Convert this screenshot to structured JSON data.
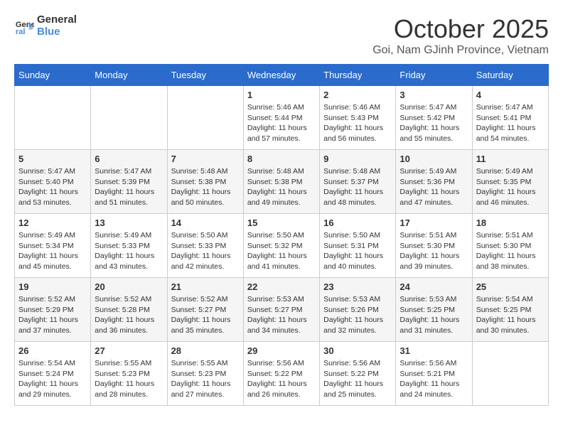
{
  "logo": {
    "line1": "General",
    "line2": "Blue"
  },
  "title": "October 2025",
  "location": "Goi, Nam GJinh Province, Vietnam",
  "days_of_week": [
    "Sunday",
    "Monday",
    "Tuesday",
    "Wednesday",
    "Thursday",
    "Friday",
    "Saturday"
  ],
  "weeks": [
    [
      {
        "day": "",
        "detail": ""
      },
      {
        "day": "",
        "detail": ""
      },
      {
        "day": "",
        "detail": ""
      },
      {
        "day": "1",
        "detail": "Sunrise: 5:46 AM\nSunset: 5:44 PM\nDaylight: 11 hours\nand 57 minutes."
      },
      {
        "day": "2",
        "detail": "Sunrise: 5:46 AM\nSunset: 5:43 PM\nDaylight: 11 hours\nand 56 minutes."
      },
      {
        "day": "3",
        "detail": "Sunrise: 5:47 AM\nSunset: 5:42 PM\nDaylight: 11 hours\nand 55 minutes."
      },
      {
        "day": "4",
        "detail": "Sunrise: 5:47 AM\nSunset: 5:41 PM\nDaylight: 11 hours\nand 54 minutes."
      }
    ],
    [
      {
        "day": "5",
        "detail": "Sunrise: 5:47 AM\nSunset: 5:40 PM\nDaylight: 11 hours\nand 53 minutes."
      },
      {
        "day": "6",
        "detail": "Sunrise: 5:47 AM\nSunset: 5:39 PM\nDaylight: 11 hours\nand 51 minutes."
      },
      {
        "day": "7",
        "detail": "Sunrise: 5:48 AM\nSunset: 5:38 PM\nDaylight: 11 hours\nand 50 minutes."
      },
      {
        "day": "8",
        "detail": "Sunrise: 5:48 AM\nSunset: 5:38 PM\nDaylight: 11 hours\nand 49 minutes."
      },
      {
        "day": "9",
        "detail": "Sunrise: 5:48 AM\nSunset: 5:37 PM\nDaylight: 11 hours\nand 48 minutes."
      },
      {
        "day": "10",
        "detail": "Sunrise: 5:49 AM\nSunset: 5:36 PM\nDaylight: 11 hours\nand 47 minutes."
      },
      {
        "day": "11",
        "detail": "Sunrise: 5:49 AM\nSunset: 5:35 PM\nDaylight: 11 hours\nand 46 minutes."
      }
    ],
    [
      {
        "day": "12",
        "detail": "Sunrise: 5:49 AM\nSunset: 5:34 PM\nDaylight: 11 hours\nand 45 minutes."
      },
      {
        "day": "13",
        "detail": "Sunrise: 5:49 AM\nSunset: 5:33 PM\nDaylight: 11 hours\nand 43 minutes."
      },
      {
        "day": "14",
        "detail": "Sunrise: 5:50 AM\nSunset: 5:33 PM\nDaylight: 11 hours\nand 42 minutes."
      },
      {
        "day": "15",
        "detail": "Sunrise: 5:50 AM\nSunset: 5:32 PM\nDaylight: 11 hours\nand 41 minutes."
      },
      {
        "day": "16",
        "detail": "Sunrise: 5:50 AM\nSunset: 5:31 PM\nDaylight: 11 hours\nand 40 minutes."
      },
      {
        "day": "17",
        "detail": "Sunrise: 5:51 AM\nSunset: 5:30 PM\nDaylight: 11 hours\nand 39 minutes."
      },
      {
        "day": "18",
        "detail": "Sunrise: 5:51 AM\nSunset: 5:30 PM\nDaylight: 11 hours\nand 38 minutes."
      }
    ],
    [
      {
        "day": "19",
        "detail": "Sunrise: 5:52 AM\nSunset: 5:29 PM\nDaylight: 11 hours\nand 37 minutes."
      },
      {
        "day": "20",
        "detail": "Sunrise: 5:52 AM\nSunset: 5:28 PM\nDaylight: 11 hours\nand 36 minutes."
      },
      {
        "day": "21",
        "detail": "Sunrise: 5:52 AM\nSunset: 5:27 PM\nDaylight: 11 hours\nand 35 minutes."
      },
      {
        "day": "22",
        "detail": "Sunrise: 5:53 AM\nSunset: 5:27 PM\nDaylight: 11 hours\nand 34 minutes."
      },
      {
        "day": "23",
        "detail": "Sunrise: 5:53 AM\nSunset: 5:26 PM\nDaylight: 11 hours\nand 32 minutes."
      },
      {
        "day": "24",
        "detail": "Sunrise: 5:53 AM\nSunset: 5:25 PM\nDaylight: 11 hours\nand 31 minutes."
      },
      {
        "day": "25",
        "detail": "Sunrise: 5:54 AM\nSunset: 5:25 PM\nDaylight: 11 hours\nand 30 minutes."
      }
    ],
    [
      {
        "day": "26",
        "detail": "Sunrise: 5:54 AM\nSunset: 5:24 PM\nDaylight: 11 hours\nand 29 minutes."
      },
      {
        "day": "27",
        "detail": "Sunrise: 5:55 AM\nSunset: 5:23 PM\nDaylight: 11 hours\nand 28 minutes."
      },
      {
        "day": "28",
        "detail": "Sunrise: 5:55 AM\nSunset: 5:23 PM\nDaylight: 11 hours\nand 27 minutes."
      },
      {
        "day": "29",
        "detail": "Sunrise: 5:56 AM\nSunset: 5:22 PM\nDaylight: 11 hours\nand 26 minutes."
      },
      {
        "day": "30",
        "detail": "Sunrise: 5:56 AM\nSunset: 5:22 PM\nDaylight: 11 hours\nand 25 minutes."
      },
      {
        "day": "31",
        "detail": "Sunrise: 5:56 AM\nSunset: 5:21 PM\nDaylight: 11 hours\nand 24 minutes."
      },
      {
        "day": "",
        "detail": ""
      }
    ]
  ]
}
